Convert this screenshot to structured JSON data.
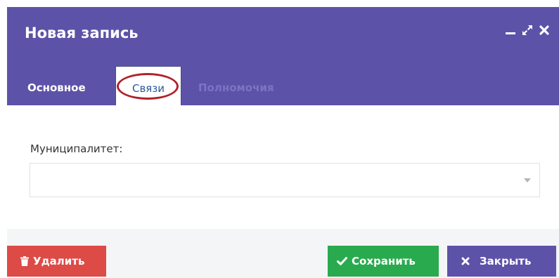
{
  "window": {
    "title": "Новая запись",
    "controls": [
      "minimize-icon",
      "maximize-icon",
      "close-icon"
    ]
  },
  "tabs": [
    {
      "label": "Основное",
      "state": "inactive"
    },
    {
      "label": "Связи",
      "state": "active"
    },
    {
      "label": "Полномочия",
      "state": "disabled"
    }
  ],
  "form": {
    "municipality_label": "Муниципалитет:",
    "municipality_value": ""
  },
  "buttons": {
    "delete": {
      "label": "Удалить",
      "icon": "trash-icon"
    },
    "save": {
      "label": "Сохранить",
      "icon": "checkmark-icon"
    },
    "close": {
      "label": "Закрыть",
      "icon": "close-icon"
    }
  },
  "colors": {
    "header": "#5c53a8",
    "active_tab_highlight": "#b0232a",
    "delete": "#dd4b47",
    "save": "#2aaa4e",
    "close": "#5c53a8"
  }
}
